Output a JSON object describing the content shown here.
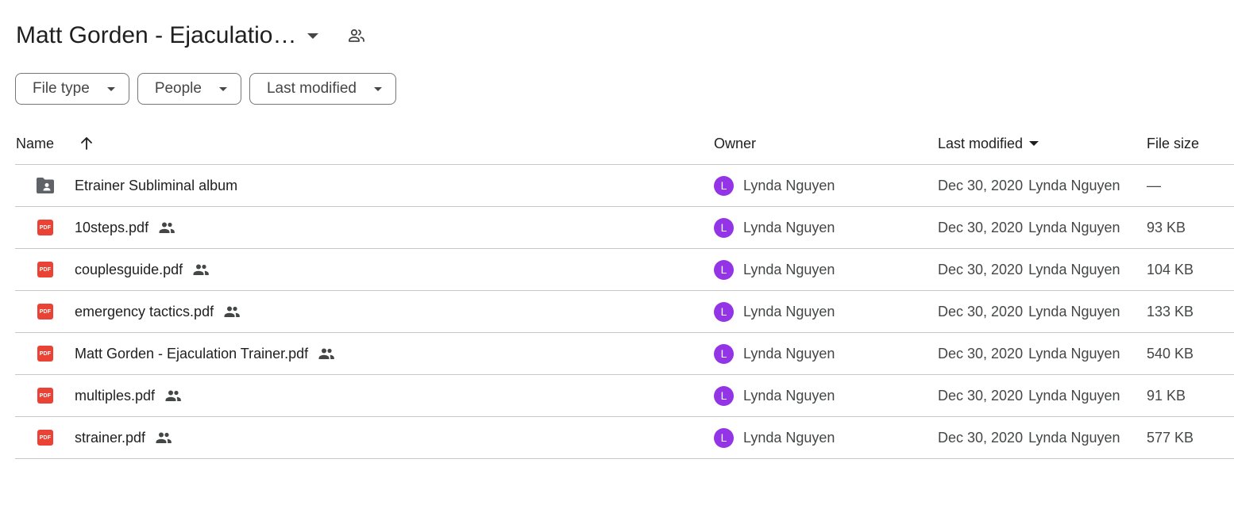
{
  "colors": {
    "pdf_red": "#ea4335",
    "avatar_purple": "#9334e6",
    "folder_gray": "#5f6368",
    "icon_gray": "#444746"
  },
  "header": {
    "title": "Matt Gorden - Ejaculatio…",
    "title_caret_icon": "caret-down-icon",
    "shared_icon": "people-outline-icon"
  },
  "filters": [
    {
      "label": "File type"
    },
    {
      "label": "People"
    },
    {
      "label": "Last modified"
    }
  ],
  "columns": {
    "name": "Name",
    "sort_icon": "arrow-up-icon",
    "owner": "Owner",
    "last_modified": "Last modified",
    "file_size": "File size"
  },
  "rows": [
    {
      "icon": "shared-folder-icon",
      "name": "Etrainer Subliminal album",
      "shared": false,
      "owner_initial": "L",
      "owner": "Lynda Nguyen",
      "date": "Dec 30, 2020",
      "modified_by": "Lynda Nguyen",
      "size": "—"
    },
    {
      "icon": "pdf-icon",
      "icon_text": "PDF",
      "name": "10steps.pdf",
      "shared": true,
      "owner_initial": "L",
      "owner": "Lynda Nguyen",
      "date": "Dec 30, 2020",
      "modified_by": "Lynda Nguyen",
      "size": "93 KB"
    },
    {
      "icon": "pdf-icon",
      "icon_text": "PDF",
      "name": "couplesguide.pdf",
      "shared": true,
      "owner_initial": "L",
      "owner": "Lynda Nguyen",
      "date": "Dec 30, 2020",
      "modified_by": "Lynda Nguyen",
      "size": "104 KB"
    },
    {
      "icon": "pdf-icon",
      "icon_text": "PDF",
      "name": "emergency tactics.pdf",
      "shared": true,
      "owner_initial": "L",
      "owner": "Lynda Nguyen",
      "date": "Dec 30, 2020",
      "modified_by": "Lynda Nguyen",
      "size": "133 KB"
    },
    {
      "icon": "pdf-icon",
      "icon_text": "PDF",
      "name": "Matt Gorden - Ejaculation Trainer.pdf",
      "shared": true,
      "owner_initial": "L",
      "owner": "Lynda Nguyen",
      "date": "Dec 30, 2020",
      "modified_by": "Lynda Nguyen",
      "size": "540 KB"
    },
    {
      "icon": "pdf-icon",
      "icon_text": "PDF",
      "name": "multiples.pdf",
      "shared": true,
      "owner_initial": "L",
      "owner": "Lynda Nguyen",
      "date": "Dec 30, 2020",
      "modified_by": "Lynda Nguyen",
      "size": "91 KB"
    },
    {
      "icon": "pdf-icon",
      "icon_text": "PDF",
      "name": "strainer.pdf",
      "shared": true,
      "owner_initial": "L",
      "owner": "Lynda Nguyen",
      "date": "Dec 30, 2020",
      "modified_by": "Lynda Nguyen",
      "size": "577 KB"
    }
  ]
}
